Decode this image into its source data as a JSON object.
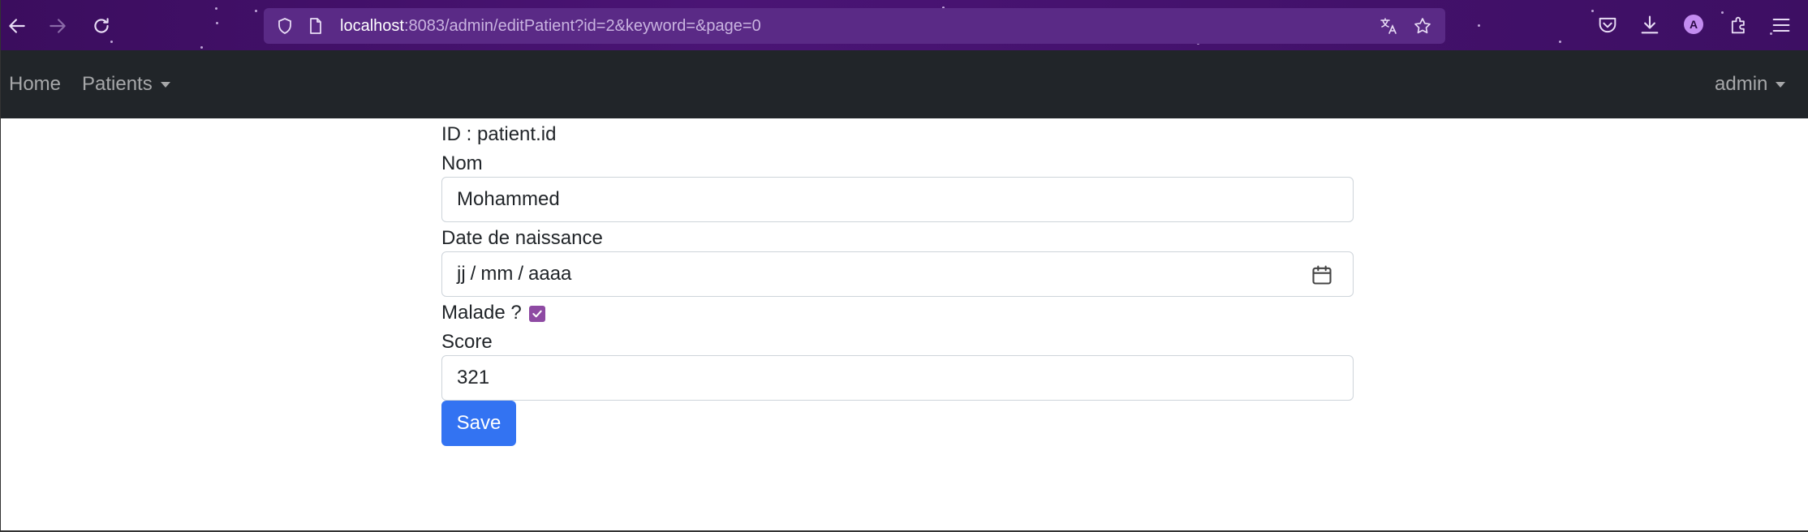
{
  "browser": {
    "url_host": "localhost",
    "url_rest": ":8083/admin/editPatient?id=2&keyword=&page=0",
    "profile_initial": "A",
    "theme_color": "#4a1475"
  },
  "navbar": {
    "home_label": "Home",
    "patients_label": "Patients",
    "user_label": "admin",
    "background": "#212529"
  },
  "form": {
    "id_text": "ID : patient.id",
    "nom_label": "Nom",
    "nom_value": "Mohammed",
    "date_label": "Date de naissance",
    "date_day_placeholder": "jj",
    "date_month_placeholder": "mm",
    "date_year_placeholder": "aaaa",
    "date_sep": "/",
    "malade_label": "Malade ?",
    "malade_checked": true,
    "score_label": "Score",
    "score_value": "321",
    "save_label": "Save",
    "save_color": "#3373f2"
  },
  "icons": {
    "back": "arrow-left-icon",
    "forward": "arrow-right-icon",
    "reload": "reload-icon",
    "shield": "shield-icon",
    "page": "page-icon",
    "translate": "translate-icon",
    "bookmark": "star-icon",
    "pocket": "pocket-icon",
    "downloads": "download-icon",
    "extensions": "puzzle-icon",
    "menu": "hamburger-menu-icon",
    "calendar": "calendar-icon"
  }
}
